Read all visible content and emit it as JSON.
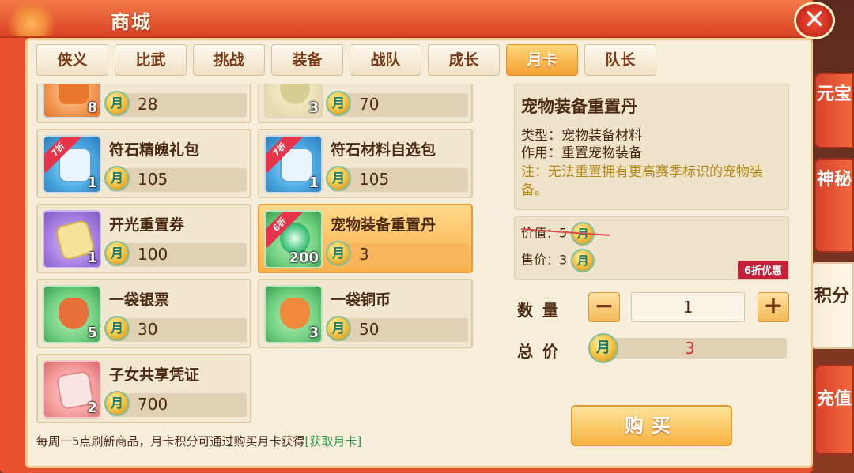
{
  "window": {
    "title": "商城",
    "close_glyph": "✕"
  },
  "tabs": [
    {
      "label": "侠义",
      "active": false
    },
    {
      "label": "比武",
      "active": false
    },
    {
      "label": "挑战",
      "active": false
    },
    {
      "label": "装备",
      "active": false
    },
    {
      "label": "战队",
      "active": false
    },
    {
      "label": "成长",
      "active": false
    },
    {
      "label": "月卡",
      "active": true
    },
    {
      "label": "队长",
      "active": false
    }
  ],
  "currency_glyph": "月",
  "items": [
    {
      "name": "",
      "count": "8",
      "price": "28",
      "icon": "orange-bag-icon",
      "badge": ""
    },
    {
      "name": "",
      "count": "3",
      "price": "70",
      "icon": "plate-icon",
      "badge": ""
    },
    {
      "name": "符石精魄礼包",
      "count": "1",
      "price": "105",
      "icon": "gift-box-icon",
      "badge": "7折"
    },
    {
      "name": "符石材料自选包",
      "count": "1",
      "price": "105",
      "icon": "gift-box-icon",
      "badge": "7折"
    },
    {
      "name": "开光重置券",
      "count": "1",
      "price": "100",
      "icon": "scroll-icon",
      "badge": ""
    },
    {
      "name": "宠物装备重置丹",
      "count": "200",
      "price": "3",
      "icon": "green-pill-icon",
      "badge": "6折",
      "selected": true
    },
    {
      "name": "一袋银票",
      "count": "5",
      "price": "30",
      "icon": "money-bag-icon",
      "badge": ""
    },
    {
      "name": "一袋铜币",
      "count": "3",
      "price": "50",
      "icon": "coin-bag-icon",
      "badge": ""
    },
    {
      "name": "子女共享凭证",
      "count": "2",
      "price": "700",
      "icon": "certificate-icon",
      "badge": ""
    }
  ],
  "footnote": {
    "text": "每周一5点刷新商品，月卡积分可通过购买月卡获得",
    "link": "[获取月卡]"
  },
  "detail": {
    "title": "宠物装备重置丹",
    "type_line": "类型：宠物装备材料",
    "use_line": "作用：重置宠物装备",
    "note": "注：无法重置拥有更高赛季标识的宠物装备。"
  },
  "pricing": {
    "original_label": "价值：5",
    "sale_label": "售价：3",
    "discount_badge": "6折优惠"
  },
  "purchase": {
    "qty_label": "数量",
    "qty_value": "1",
    "minus": "−",
    "plus": "+",
    "total_label": "总价",
    "total_value": "3",
    "buy_label": "购买"
  },
  "side_tabs": [
    {
      "label": "元宝",
      "active": false
    },
    {
      "label": "神秘",
      "active": false
    },
    {
      "label": "积分",
      "active": true
    },
    {
      "label": "充值",
      "active": false
    }
  ]
}
